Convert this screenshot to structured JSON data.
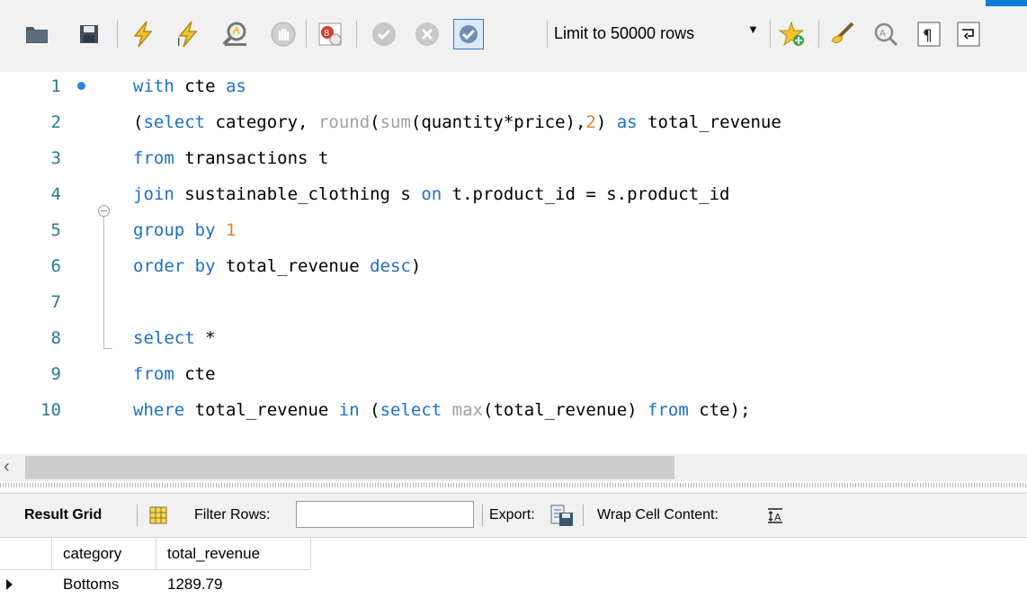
{
  "toolbar": {
    "limit_label": "Limit to 50000 rows",
    "icons": [
      "folder-icon",
      "save-icon",
      "execute-icon",
      "execute-current-icon",
      "explain-icon",
      "stop-icon",
      "toggle-continue-on-error-icon",
      "commit-icon",
      "rollback-icon",
      "autocommit-icon",
      "add-snippet-icon",
      "beautify-icon",
      "find-icon",
      "invisible-chars-icon",
      "word-wrap-icon"
    ]
  },
  "editor": {
    "lines": [
      {
        "n": "1",
        "tokens": [
          {
            "t": "with",
            "c": "kw"
          },
          {
            "t": " cte ",
            "c": ""
          },
          {
            "t": "as",
            "c": "kw"
          }
        ]
      },
      {
        "n": "2",
        "tokens": [
          {
            "t": "(",
            "c": ""
          },
          {
            "t": "select",
            "c": "kw"
          },
          {
            "t": " category, ",
            "c": ""
          },
          {
            "t": "round",
            "c": "fn"
          },
          {
            "t": "(",
            "c": ""
          },
          {
            "t": "sum",
            "c": "fn"
          },
          {
            "t": "(quantity*price),",
            "c": ""
          },
          {
            "t": "2",
            "c": "num"
          },
          {
            "t": ") ",
            "c": ""
          },
          {
            "t": "as",
            "c": "kw"
          },
          {
            "t": " total_revenue",
            "c": ""
          }
        ]
      },
      {
        "n": "3",
        "tokens": [
          {
            "t": "from",
            "c": "kw"
          },
          {
            "t": " transactions t",
            "c": ""
          }
        ]
      },
      {
        "n": "4",
        "tokens": [
          {
            "t": "join",
            "c": "kw"
          },
          {
            "t": " sustainable_clothing s ",
            "c": ""
          },
          {
            "t": "on",
            "c": "kw"
          },
          {
            "t": " t.product_id = s.product_id",
            "c": ""
          }
        ]
      },
      {
        "n": "5",
        "tokens": [
          {
            "t": "group by",
            "c": "kw"
          },
          {
            "t": " ",
            "c": ""
          },
          {
            "t": "1",
            "c": "num"
          }
        ]
      },
      {
        "n": "6",
        "tokens": [
          {
            "t": "order by",
            "c": "kw"
          },
          {
            "t": " total_revenue ",
            "c": ""
          },
          {
            "t": "desc",
            "c": "kw"
          },
          {
            "t": ")",
            "c": ""
          }
        ]
      },
      {
        "n": "7",
        "tokens": []
      },
      {
        "n": "8",
        "tokens": [
          {
            "t": "select",
            "c": "kw"
          },
          {
            "t": " *",
            "c": ""
          }
        ]
      },
      {
        "n": "9",
        "tokens": [
          {
            "t": "from",
            "c": "kw"
          },
          {
            "t": " cte",
            "c": ""
          }
        ]
      },
      {
        "n": "10",
        "tokens": [
          {
            "t": "where",
            "c": "kw"
          },
          {
            "t": " total_revenue ",
            "c": ""
          },
          {
            "t": "in",
            "c": "kw"
          },
          {
            "t": " (",
            "c": ""
          },
          {
            "t": "select",
            "c": "kw"
          },
          {
            "t": " ",
            "c": ""
          },
          {
            "t": "max",
            "c": "fn"
          },
          {
            "t": "(total_revenue) ",
            "c": ""
          },
          {
            "t": "from",
            "c": "kw"
          },
          {
            "t": " cte);",
            "c": ""
          }
        ]
      }
    ]
  },
  "results": {
    "result_grid_label": "Result Grid",
    "filter_label": "Filter Rows:",
    "filter_value": "",
    "export_label": "Export:",
    "wrap_label": "Wrap Cell Content:",
    "columns": [
      "category",
      "total_revenue"
    ],
    "rows": [
      [
        "Bottoms",
        "1289.79"
      ]
    ]
  },
  "colors": {
    "keyword": "#1d6fc8",
    "function": "#a0a0a0",
    "number": "#e0842d",
    "line_number": "#2b7a8b",
    "accent": "#0f7ad7"
  }
}
